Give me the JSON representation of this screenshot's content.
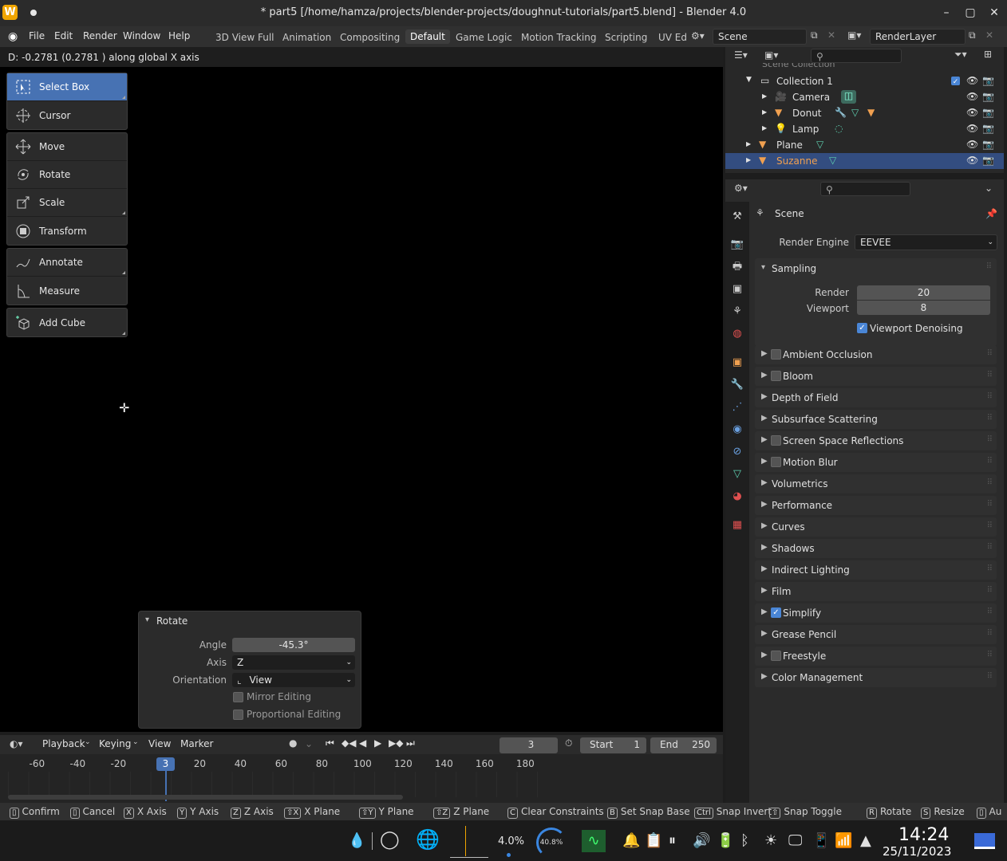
{
  "window": {
    "title": "* part5 [/home/hamza/projects/blender-projects/doughnut-tutorials/part5.blend] - Blender 4.0",
    "icon_letter": "W"
  },
  "menu": [
    "File",
    "Edit",
    "Render",
    "Window",
    "Help"
  ],
  "workspaces": [
    "3D View Full",
    "Animation",
    "Compositing",
    "Default",
    "Game Logic",
    "Motion Tracking",
    "Scripting",
    "UV Ed"
  ],
  "active_workspace": "Default",
  "scene_field": "Scene",
  "renderlayer_field": "RenderLayer",
  "header_info": "D: -0.2781  (0.2781 ) along global X axis",
  "tools": [
    {
      "label": "Select Box",
      "icon": "select-box-icon",
      "active": true
    },
    {
      "label": "Cursor",
      "icon": "cursor-icon"
    },
    {
      "label": "Move",
      "icon": "move-icon"
    },
    {
      "label": "Rotate",
      "icon": "rotate-icon"
    },
    {
      "label": "Scale",
      "icon": "scale-icon"
    },
    {
      "label": "Transform",
      "icon": "transform-icon"
    },
    {
      "label": "Annotate",
      "icon": "annotate-icon"
    },
    {
      "label": "Measure",
      "icon": "measure-icon"
    },
    {
      "label": "Add Cube",
      "icon": "add-cube-icon"
    }
  ],
  "redo_panel": {
    "title": "Rotate",
    "angle_label": "Angle",
    "angle_value": "-45.3°",
    "axis_label": "Axis",
    "axis_value": "Z",
    "orientation_label": "Orientation",
    "orientation_value": "View",
    "mirror_label": "Mirror Editing",
    "proportional_label": "Proportional Editing"
  },
  "outliner": {
    "header_row": "Scene Collection",
    "rows": [
      {
        "label": "Collection 1",
        "indent": 1
      },
      {
        "label": "Camera",
        "indent": 2
      },
      {
        "label": "Donut",
        "indent": 2
      },
      {
        "label": "Lamp",
        "indent": 2
      },
      {
        "label": "Plane",
        "indent": 1
      },
      {
        "label": "Suzanne",
        "indent": 1,
        "selected": true
      }
    ]
  },
  "properties": {
    "context": "Scene",
    "render_engine_label": "Render Engine",
    "render_engine_value": "EEVEE",
    "sampling_label": "Sampling",
    "render_label": "Render",
    "render_value": "20",
    "viewport_label": "Viewport",
    "viewport_value": "8",
    "denoise_label": "Viewport Denoising",
    "panels": [
      {
        "label": "Ambient Occlusion",
        "checkbox": "off"
      },
      {
        "label": "Bloom",
        "checkbox": "off"
      },
      {
        "label": "Depth of Field"
      },
      {
        "label": "Subsurface Scattering"
      },
      {
        "label": "Screen Space Reflections",
        "checkbox": "off"
      },
      {
        "label": "Motion Blur",
        "checkbox": "off"
      },
      {
        "label": "Volumetrics"
      },
      {
        "label": "Performance"
      },
      {
        "label": "Curves"
      },
      {
        "label": "Shadows"
      },
      {
        "label": "Indirect Lighting"
      },
      {
        "label": "Film"
      },
      {
        "label": "Simplify",
        "checkbox": "on"
      },
      {
        "label": "Grease Pencil"
      },
      {
        "label": "Freestyle",
        "checkbox": "off"
      },
      {
        "label": "Color Management"
      }
    ]
  },
  "timeline": {
    "menus": [
      "Playback",
      "Keying",
      "View",
      "Marker"
    ],
    "current_frame": "3",
    "start_label": "Start",
    "start_value": "1",
    "end_label": "End",
    "end_value": "250",
    "ruler": [
      "-60",
      "-40",
      "-20",
      "3",
      "20",
      "40",
      "60",
      "80",
      "100",
      "120",
      "140",
      "160",
      "180"
    ]
  },
  "statusbar": [
    {
      "key": "",
      "label": "Confirm"
    },
    {
      "key": "",
      "label": "Cancel"
    },
    {
      "key": "X",
      "label": "X Axis"
    },
    {
      "key": "Y",
      "label": "Y Axis"
    },
    {
      "key": "Z",
      "label": "Z Axis"
    },
    {
      "key": "⇧X",
      "label": "X Plane"
    },
    {
      "key": "⇧Y",
      "label": "Y Plane"
    },
    {
      "key": "⇧Z",
      "label": "Z Plane"
    },
    {
      "key": "C",
      "label": "Clear Constraints"
    },
    {
      "key": "B",
      "label": "Set Snap Base"
    },
    {
      "key": "Ctrl",
      "label": "Snap Invert"
    },
    {
      "key": "⇧",
      "label": "Snap Toggle"
    },
    {
      "key": "R",
      "label": "Rotate"
    },
    {
      "key": "S",
      "label": "Resize"
    },
    {
      "key": "",
      "label": "Au"
    }
  ],
  "taskbar": {
    "cpu": "4.0%",
    "mem": "40.8%",
    "time": "14:24",
    "date": "25/11/2023"
  },
  "colors": {
    "accent_blue": "#4772b3",
    "selected_orange": "#f0a050"
  }
}
